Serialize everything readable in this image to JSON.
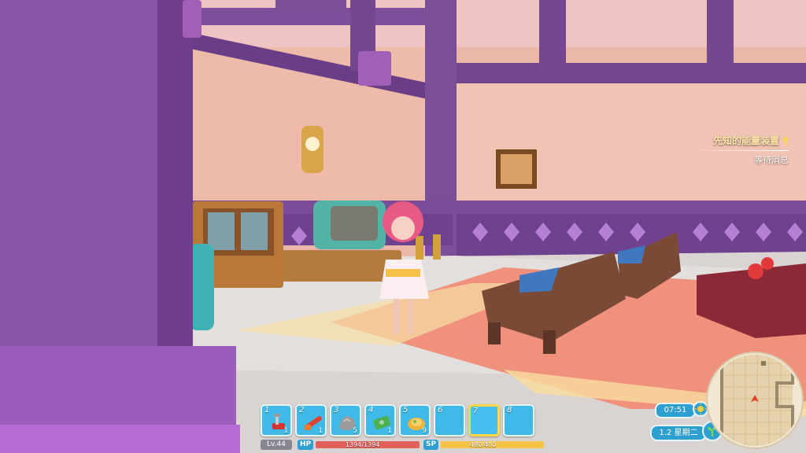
{
  "quest": {
    "title": "先知的能量装置",
    "status": "等待消息"
  },
  "hotbar": {
    "slots": [
      {
        "num": "1",
        "icon": "toolbox-icon",
        "count": "1"
      },
      {
        "num": "2",
        "icon": "chainsaw-icon",
        "count": "1"
      },
      {
        "num": "3",
        "icon": "stone-icon",
        "count": "5"
      },
      {
        "num": "4",
        "icon": "money-icon",
        "count": "1"
      },
      {
        "num": "5",
        "icon": "food-plate-icon",
        "count": "9"
      },
      {
        "num": "6",
        "icon": "",
        "count": ""
      },
      {
        "num": "7",
        "icon": "",
        "count": ""
      },
      {
        "num": "8",
        "icon": "",
        "count": ""
      }
    ],
    "selected_slot": 7
  },
  "status": {
    "level": "Lv.44",
    "hp_label": "HP",
    "hp_text": "1394/1394",
    "hp_current": 1394,
    "hp_max": 1394,
    "sp_label": "SP",
    "sp_text": "480/480",
    "sp_current": 480,
    "sp_max": 480
  },
  "clock": {
    "time": "07:51",
    "date": "1.2 星期二"
  },
  "colors": {
    "ui_blue": "#2d9fd0",
    "hp_red": "#e0605a",
    "sp_yellow": "#f3c34a",
    "selected_gold": "#ffd84a"
  }
}
